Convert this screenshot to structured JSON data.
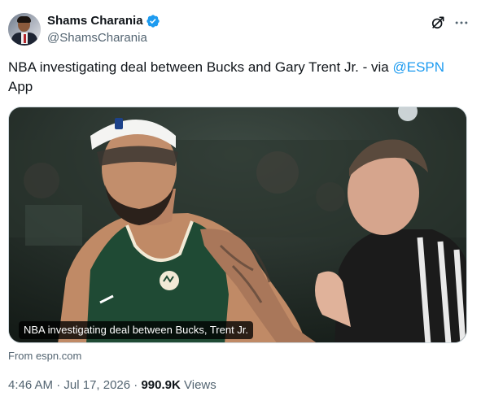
{
  "author": {
    "display_name": "Shams Charania",
    "handle": "@ShamsCharania",
    "verified": true
  },
  "tweet": {
    "text_before": "NBA investigating deal between Bucks and Gary Trent Jr. - via ",
    "mention": "@ESPN",
    "text_after": " App"
  },
  "card": {
    "caption": "NBA investigating deal between Bucks, Trent Jr.",
    "source": "From espn.com"
  },
  "meta": {
    "time": "4:46 AM",
    "separator1": " · ",
    "date": "Jul 17, 2026",
    "separator2": " · ",
    "views_count": "990.9K",
    "views_label": " Views"
  },
  "icons": {
    "grok": "grok-icon",
    "more": "more-icon",
    "verified": "verified-badge-icon"
  },
  "colors": {
    "link": "#1d9bf0",
    "text_primary": "#0f1419",
    "text_secondary": "#536471",
    "jersey_green": "#1f4a34"
  }
}
